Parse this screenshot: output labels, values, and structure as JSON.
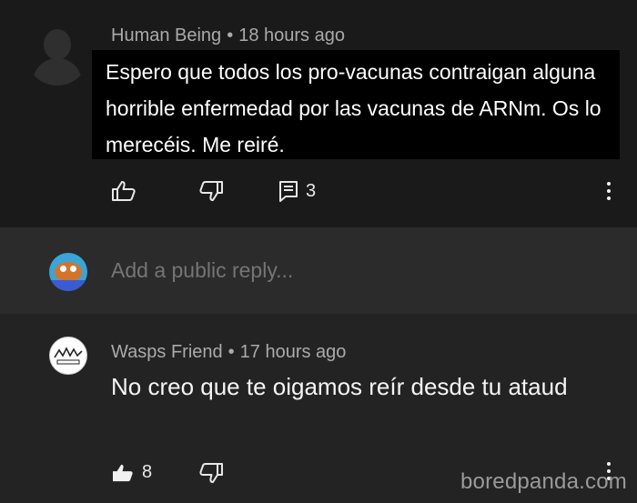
{
  "comments": [
    {
      "author": "Human Being",
      "time": "18 hours ago",
      "text": "Espero que todos los pro-vacunas contraigan alguna horrible enfermedad por las vacunas de ARNm. Os lo merecéis. Me reiré.",
      "replies_count": "3",
      "icons": {
        "like": "thumbs-up-outline-icon",
        "dislike": "thumbs-down-outline-icon",
        "reply": "reply-comment-icon",
        "more": "vertical-dots-icon"
      }
    },
    {
      "author": "Wasps Friend",
      "time": "17 hours ago",
      "text": "No creo que te oigamos reír desde tu ataud",
      "likes": "8",
      "icons": {
        "like": "thumbs-up-filled-icon",
        "dislike": "thumbs-down-outline-icon",
        "more": "vertical-dots-icon"
      }
    }
  ],
  "reply_box": {
    "placeholder": "Add a public reply..."
  },
  "separator": "•",
  "watermark": "boredpanda.com",
  "colors": {
    "text_highlight_bg": "#000000",
    "background_dark": "#1a1a1a",
    "background_mid": "#2b2b2b",
    "meta_text": "#aaaaaa"
  }
}
